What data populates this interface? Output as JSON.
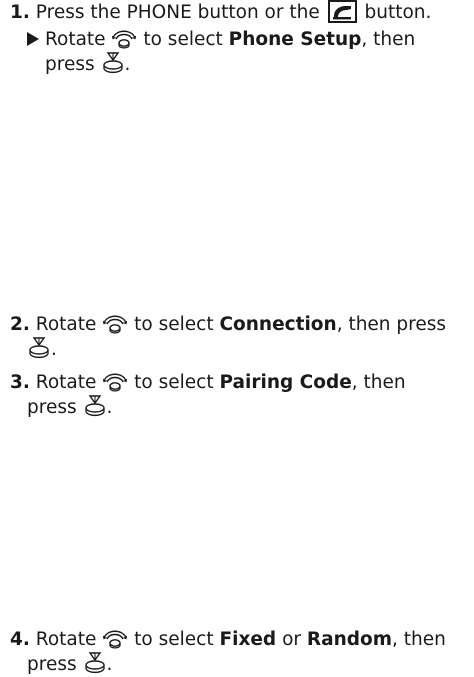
{
  "step1": {
    "number": "1.",
    "text_a": "Press the PHONE button or the",
    "text_b": "button.",
    "sub_a": "Rotate",
    "sub_b": "to select",
    "sub_bold": "Phone Setup",
    "sub_c": ", then",
    "sub_d": "press",
    "sub_e": "."
  },
  "step2": {
    "number": "2.",
    "text_a": "Rotate",
    "text_b": "to select",
    "bold": "Connection",
    "text_c": ", then press",
    "text_d": "."
  },
  "step3": {
    "number": "3.",
    "text_a": "Rotate",
    "text_b": "to select",
    "bold": "Pairing Code",
    "text_c": ", then",
    "text_d": "press",
    "text_e": "."
  },
  "step4": {
    "number": "4.",
    "text_a": "Rotate",
    "text_b": "to select",
    "bold_a": "Fixed",
    "text_c": "or",
    "bold_b": "Random",
    "text_d": ", then",
    "text_e": "press",
    "text_f": "."
  },
  "icons": {
    "dial": "selector-dial-icon",
    "press": "press-selector-icon",
    "phone": "phone-button-icon",
    "arrow": "arrow-right-icon"
  }
}
